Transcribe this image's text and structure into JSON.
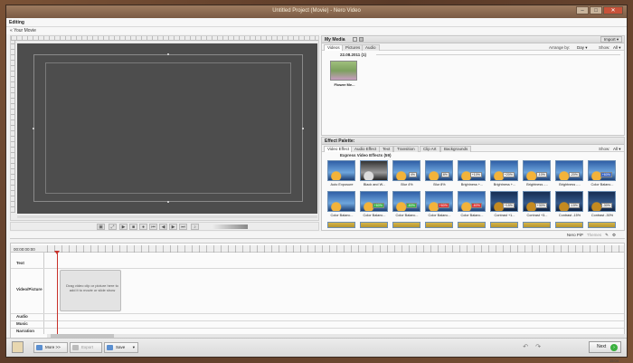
{
  "window": {
    "title": "Untitled Project (Movie) - Nero Video",
    "mode_label": "Editing",
    "breadcrumb": "« Your Movie",
    "controls": [
      "–",
      "□",
      "✕"
    ]
  },
  "my_media": {
    "header": "My Media",
    "tabs": [
      "Videos",
      "Pictures",
      "Audio"
    ],
    "arrange_label": "Arrange by:",
    "arrange_value": "Day ▾",
    "show_label": "Show:",
    "show_value": "All ▾",
    "import_label": "Import ▾",
    "group_date": "22.08.2011 (1)",
    "items": [
      {
        "name": "Flower Me..."
      }
    ]
  },
  "effect_palette": {
    "header": "Effect Palette:",
    "tabs": [
      "Video Effect",
      "Audio Effect",
      "Text",
      "Transition",
      "Clip Art",
      "Backgrounds"
    ],
    "show_label": "Show:",
    "show_value": "All ▾",
    "section": "Express Video Effects (59)",
    "effects": [
      {
        "label": "Auto Exposure",
        "badge": "",
        "style": ""
      },
      {
        "label": "Black and W...",
        "badge": "",
        "style": "bw"
      },
      {
        "label": "Blur 4%",
        "badge": "4%",
        "style": ""
      },
      {
        "label": "Blur 8%",
        "badge": "8%",
        "style": ""
      },
      {
        "label": "Brightness +...",
        "badge": "+10%",
        "style": ""
      },
      {
        "label": "Brightness +...",
        "badge": "+20%",
        "style": ""
      },
      {
        "label": "Brightness -...",
        "badge": "-10%",
        "style": ""
      },
      {
        "label": "Brightness -...",
        "badge": "-20%",
        "style": ""
      },
      {
        "label": "Color Balanc...",
        "badge": "+60%",
        "style": "b"
      },
      {
        "label": "Color Balanc...",
        "badge": "",
        "style": "b"
      },
      {
        "label": "Color Balanc...",
        "badge": "+60%",
        "style": "g"
      },
      {
        "label": "Color Balanc...",
        "badge": "-60%",
        "style": "g"
      },
      {
        "label": "Color Balanc...",
        "badge": "+60%",
        "style": "r"
      },
      {
        "label": "Color Balanc...",
        "badge": "-60%",
        "style": "r"
      },
      {
        "label": "Contrast +1...",
        "badge": "+15%",
        "style": "dk"
      },
      {
        "label": "Contrast +3...",
        "badge": "+30%",
        "style": "dk"
      },
      {
        "label": "Contrast -15%",
        "badge": "-15%",
        "style": "dk"
      },
      {
        "label": "Contrast -30%",
        "badge": "-30%",
        "style": "dk"
      }
    ]
  },
  "timeline": {
    "timecode": "00:00:00:00",
    "tools": [
      "Nero PiP",
      "Themes"
    ],
    "tracks": [
      "Text",
      "Video/Picture",
      "Audio",
      "Music",
      "Narration"
    ],
    "drop_hint": "Drag video clip or picture here to add it to movie or slide show"
  },
  "bottom": {
    "more_label": "More >>",
    "export_label": "Export",
    "save_label": "Save",
    "save_arrow": "▾",
    "next_label": "Next",
    "clock": "15:04"
  }
}
